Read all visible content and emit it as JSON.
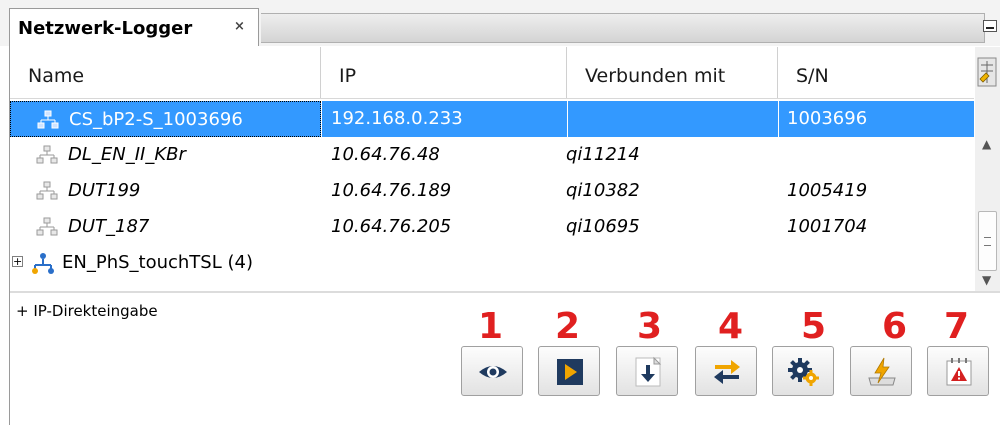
{
  "panel": {
    "title": "Netzwerk-Logger",
    "close_glyph": "×"
  },
  "table": {
    "columns": [
      "Name",
      "IP",
      "Verbunden mit",
      "S/N"
    ],
    "rows": [
      {
        "name": "CS_bP2-S_1003696",
        "ip": "192.168.0.233",
        "connected": "",
        "sn": "1003696",
        "selected": true,
        "italic": false
      },
      {
        "name": "DL_EN_II_KBr",
        "ip": "10.64.76.48",
        "connected": "qi11214",
        "sn": "",
        "selected": false,
        "italic": true
      },
      {
        "name": "DUT199",
        "ip": "10.64.76.189",
        "connected": "qi10382",
        "sn": "1005419",
        "selected": false,
        "italic": true
      },
      {
        "name": "DUT_187",
        "ip": "10.64.76.205",
        "connected": "qi10695",
        "sn": "1001704",
        "selected": false,
        "italic": true
      }
    ],
    "group": {
      "label": "EN_PhS_touchTSL (4)",
      "expand_glyph": "+"
    }
  },
  "ip_direct_label": "+ IP-Direkteingabe",
  "toolbar": {
    "numbers": [
      "1",
      "2",
      "3",
      "4",
      "5",
      "6",
      "7"
    ],
    "buttons": [
      "eye-icon",
      "play-icon",
      "download-icon",
      "swap-icon",
      "gear-icon",
      "flash-icon",
      "alarm-icon"
    ]
  },
  "colors": {
    "selection": "#3399ff",
    "number_red": "#e02020",
    "accent_orange": "#f0a500",
    "icon_navy": "#1f3a5f"
  }
}
